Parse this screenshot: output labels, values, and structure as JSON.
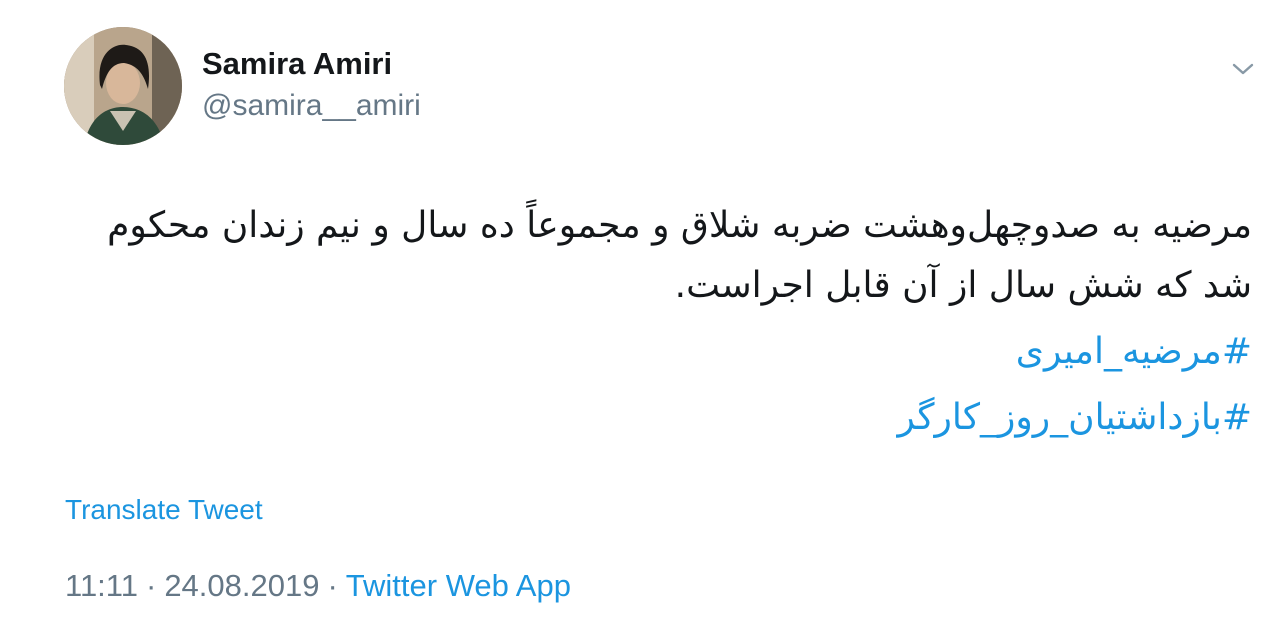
{
  "author": {
    "display_name": "Samira Amiri",
    "handle": "@samira__amiri"
  },
  "tweet": {
    "text": "مرضیه به صدوچهل‌وهشت ضربه شلاق و مجموعاً ده سال و نیم زندان محکوم شد که شش سال از آن قابل اجراست.",
    "hashtags": [
      "#مرضیه_امیری",
      "#بازداشتیان_روز_کارگر"
    ]
  },
  "translate_label": "Translate Tweet",
  "meta": {
    "time": "11:11",
    "date": "24.08.2019",
    "separator": "·",
    "source": "Twitter Web App"
  },
  "icons": {
    "menu": "chevron-down-icon"
  },
  "colors": {
    "link": "#1b95e0",
    "secondary_text": "#657786",
    "primary_text": "#14171a"
  }
}
